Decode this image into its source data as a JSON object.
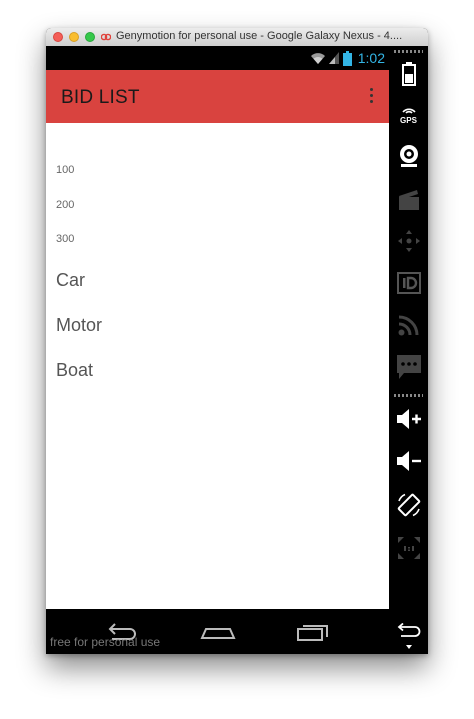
{
  "window": {
    "title": "Genymotion for personal use - Google Galaxy Nexus - 4...."
  },
  "statusbar": {
    "time": "1:02"
  },
  "appbar": {
    "title": "BID LIST"
  },
  "bids": [
    "100",
    "200",
    "300"
  ],
  "items": [
    "Car",
    "Motor",
    "Boat"
  ],
  "navbar": {
    "watermark": "free for personal use"
  },
  "sidebar": {
    "gps_label": "GPS",
    "icons": [
      "battery-icon",
      "gps-icon",
      "camera-icon",
      "clapper-icon",
      "dpad-icon",
      "id-icon",
      "rss-icon",
      "sms-icon",
      "volume-up-icon",
      "volume-down-icon",
      "rotate-icon",
      "scale-icon",
      "back-icon",
      "menu-arrow-icon"
    ]
  },
  "colors": {
    "appbar": "#d9433f",
    "clock": "#33b5e5",
    "item_text": "#555555"
  }
}
